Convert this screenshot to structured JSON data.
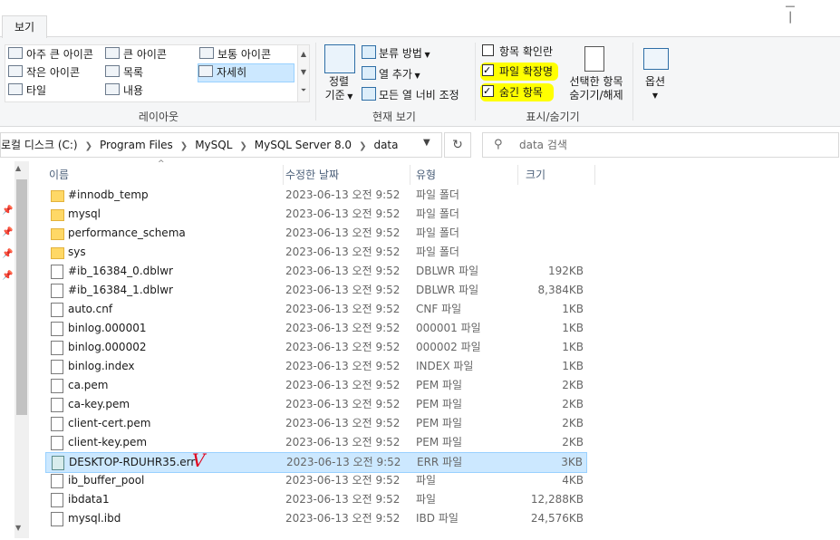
{
  "ribbon": {
    "tab_view": "보기",
    "layout": {
      "items": [
        "아주 큰 아이콘",
        "큰 아이콘",
        "보통 아이콘",
        "작은 아이콘",
        "목록",
        "자세히",
        "타일",
        "내용"
      ],
      "group_label": "레이아웃"
    },
    "current_view": {
      "sort_by": "정렬\n기준",
      "sort_by_line1": "정렬",
      "sort_by_line2": "기준",
      "group_by": "분류 방법",
      "add_columns": "열 추가",
      "size_all_columns": "모든 열 너비 조정",
      "group_label": "현재 보기"
    },
    "show_hide": {
      "item_checkboxes": "항목 확인란",
      "file_extensions": "파일 확장명",
      "hidden_items": "숨긴 항목",
      "hide_selected_line1": "선택한 항목",
      "hide_selected_line2": "숨기기/해제",
      "group_label": "표시/숨기기",
      "item_checkboxes_checked": false,
      "file_extensions_checked": true,
      "hidden_items_checked": true
    },
    "options": "옵션"
  },
  "address": {
    "crumbs": [
      "로컬 디스크 (C:)",
      "Program Files",
      "MySQL",
      "MySQL Server 8.0",
      "data"
    ],
    "search_placeholder": "data 검색"
  },
  "columns": {
    "name": "이름",
    "modified": "수정한 날짜",
    "type": "유형",
    "size": "크기"
  },
  "files": [
    {
      "name": "#innodb_temp",
      "date": "2023-06-13 오전 9:52",
      "type": "파일 폴더",
      "size": "",
      "kind": "folder"
    },
    {
      "name": "mysql",
      "date": "2023-06-13 오전 9:52",
      "type": "파일 폴더",
      "size": "",
      "kind": "folder"
    },
    {
      "name": "performance_schema",
      "date": "2023-06-13 오전 9:52",
      "type": "파일 폴더",
      "size": "",
      "kind": "folder"
    },
    {
      "name": "sys",
      "date": "2023-06-13 오전 9:52",
      "type": "파일 폴더",
      "size": "",
      "kind": "folder"
    },
    {
      "name": "#ib_16384_0.dblwr",
      "date": "2023-06-13 오전 9:52",
      "type": "DBLWR 파일",
      "size": "192KB",
      "kind": "file"
    },
    {
      "name": "#ib_16384_1.dblwr",
      "date": "2023-06-13 오전 9:52",
      "type": "DBLWR 파일",
      "size": "8,384KB",
      "kind": "file"
    },
    {
      "name": "auto.cnf",
      "date": "2023-06-13 오전 9:52",
      "type": "CNF 파일",
      "size": "1KB",
      "kind": "file"
    },
    {
      "name": "binlog.000001",
      "date": "2023-06-13 오전 9:52",
      "type": "000001 파일",
      "size": "1KB",
      "kind": "file"
    },
    {
      "name": "binlog.000002",
      "date": "2023-06-13 오전 9:52",
      "type": "000002 파일",
      "size": "1KB",
      "kind": "file"
    },
    {
      "name": "binlog.index",
      "date": "2023-06-13 오전 9:52",
      "type": "INDEX 파일",
      "size": "1KB",
      "kind": "file"
    },
    {
      "name": "ca.pem",
      "date": "2023-06-13 오전 9:52",
      "type": "PEM 파일",
      "size": "2KB",
      "kind": "file"
    },
    {
      "name": "ca-key.pem",
      "date": "2023-06-13 오전 9:52",
      "type": "PEM 파일",
      "size": "2KB",
      "kind": "file"
    },
    {
      "name": "client-cert.pem",
      "date": "2023-06-13 오전 9:52",
      "type": "PEM 파일",
      "size": "2KB",
      "kind": "file"
    },
    {
      "name": "client-key.pem",
      "date": "2023-06-13 오전 9:52",
      "type": "PEM 파일",
      "size": "2KB",
      "kind": "file"
    },
    {
      "name": "DESKTOP-RDUHR35.err",
      "date": "2023-06-13 오전 9:52",
      "type": "ERR 파일",
      "size": "3KB",
      "kind": "err",
      "selected": true
    },
    {
      "name": "ib_buffer_pool",
      "date": "2023-06-13 오전 9:52",
      "type": "파일",
      "size": "4KB",
      "kind": "file"
    },
    {
      "name": "ibdata1",
      "date": "2023-06-13 오전 9:52",
      "type": "파일",
      "size": "12,288KB",
      "kind": "file"
    },
    {
      "name": "mysql.ibd",
      "date": "2023-06-13 오전 9:52",
      "type": "IBD 파일",
      "size": "24,576KB",
      "kind": "file"
    }
  ],
  "annotation_mark": "V",
  "colors": {
    "selection": "#cce8ff",
    "highlight": "#ffff00",
    "mark": "#e0001a"
  }
}
